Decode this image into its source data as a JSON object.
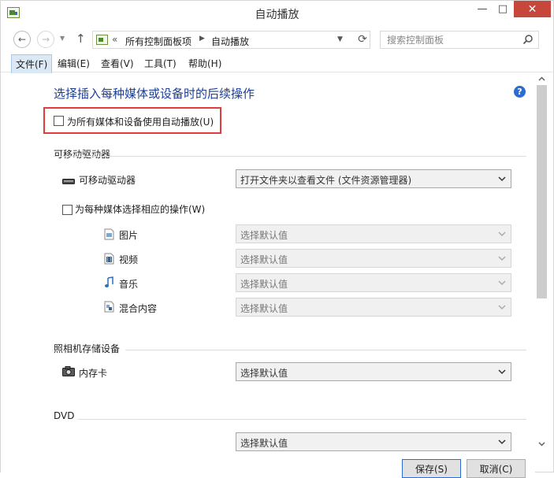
{
  "window": {
    "title": "自动播放",
    "controls": {
      "minimize": "—",
      "maximize": "□",
      "close": "✕"
    }
  },
  "addressbar": {
    "crumb_sep0": "«",
    "crumb1": "所有控制面板项",
    "crumb_sep1": "▶",
    "crumb2": "自动播放",
    "search_placeholder": "搜索控制面板"
  },
  "menu": {
    "items": [
      "文件(F)",
      "编辑(E)",
      "查看(V)",
      "工具(T)",
      "帮助(H)"
    ]
  },
  "content": {
    "heading": "选择插入每种媒体或设备时的后续操作",
    "help": "?",
    "use_autoplay_label": "为所有媒体和设备使用自动播放(U)",
    "section_removable": "可移动驱动器",
    "removable_drive": {
      "label": "可移动驱动器",
      "selected": "打开文件夹以查看文件 (文件资源管理器)"
    },
    "per_type_label": "为每种媒体选择相应的操作(W)",
    "media_types": [
      {
        "label": "图片",
        "selected": "选择默认值"
      },
      {
        "label": "视频",
        "selected": "选择默认值"
      },
      {
        "label": "音乐",
        "selected": "选择默认值"
      },
      {
        "label": "混合内容",
        "selected": "选择默认值"
      }
    ],
    "section_camera": "照相机存储设备",
    "memory_card": {
      "label": "内存卡",
      "selected": "选择默认值"
    },
    "section_dvd": "DVD",
    "dvd_select": {
      "selected": "选择默认值"
    }
  },
  "buttons": {
    "save": "保存(S)",
    "cancel": "取消(C)"
  }
}
